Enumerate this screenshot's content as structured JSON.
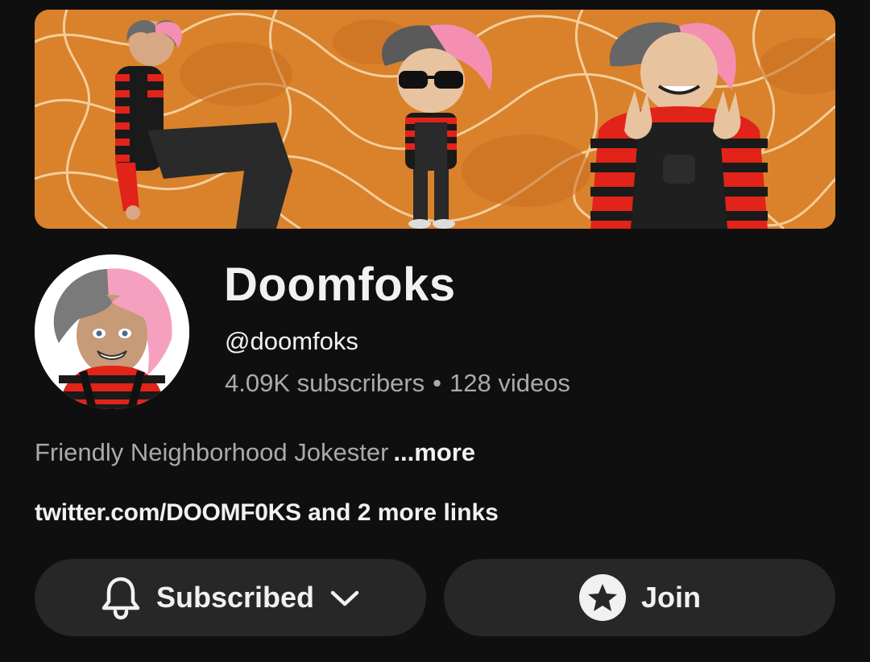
{
  "channel": {
    "name": "Doomfoks",
    "handle": "@doomfoks",
    "subscribers": "4.09K subscribers",
    "separator": "•",
    "videos": "128 videos",
    "description": "Friendly Neighborhood Jokester",
    "description_more": "...more",
    "links_primary": "twitter.com/DOOMF0KS",
    "links_extra": "and 2 more links"
  },
  "actions": {
    "subscribed_label": "Subscribed",
    "join_label": "Join"
  },
  "icons": {
    "subscribed": "bell-icon",
    "subscribed_menu": "chevron-down-icon",
    "join": "star-icon"
  },
  "colors": {
    "background": "#0f0f0f",
    "button_background": "#272727",
    "primary_text": "#f1f1f1",
    "secondary_text": "#aaaaaa",
    "banner_orange": "#d9822b"
  }
}
